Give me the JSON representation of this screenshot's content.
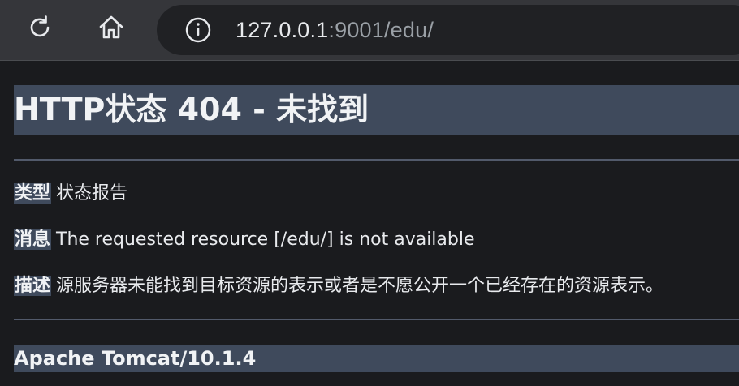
{
  "browser": {
    "url_host": "127.0.0.1",
    "url_rest": ":9001/edu/",
    "icons": {
      "reload": "reload-icon",
      "home": "home-icon",
      "site_info": "info-icon"
    }
  },
  "page": {
    "title": "HTTP状态 404 - 未找到",
    "type_label": "类型",
    "type_value": "状态报告",
    "message_label": "消息",
    "message_value": "The requested resource [/edu/] is not available",
    "description_label": "描述",
    "description_value": "源服务器未能找到目标资源的表示或者是不愿公开一个已经存在的资源表示。",
    "server_info": "Apache Tomcat/10.1.4"
  },
  "colors": {
    "toolbar_bg": "#35363a",
    "page_bg": "#1a1b1e",
    "heading_bg": "#3f4a5c",
    "url_dim": "#9aa0a6"
  }
}
